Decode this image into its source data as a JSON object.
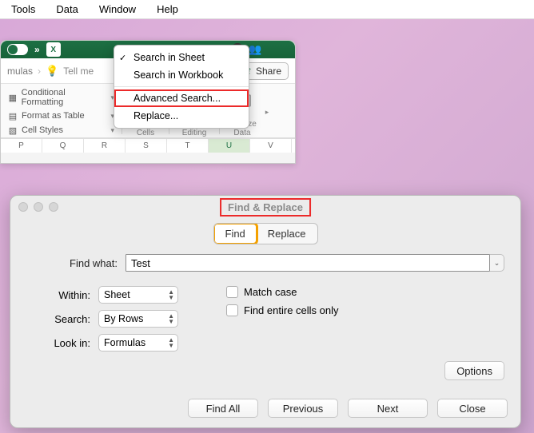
{
  "menubar": {
    "items": [
      "Tools",
      "Data",
      "Window",
      "Help"
    ]
  },
  "ribbon": {
    "tab": "mulas",
    "tellme": "Tell me",
    "share": "Share",
    "styles": {
      "conditional": "Conditional Formatting",
      "format_table": "Format as Table",
      "cell_styles": "Cell Styles"
    },
    "groups": {
      "cells": "Cells",
      "editing": "Editing",
      "analyze": "Analyze\nData"
    }
  },
  "columns": [
    "P",
    "Q",
    "R",
    "S",
    "T",
    "U",
    "V"
  ],
  "dropdown": {
    "search_sheet": "Search in Sheet",
    "search_workbook": "Search in Workbook",
    "advanced": "Advanced Search...",
    "replace": "Replace..."
  },
  "dialog": {
    "title": "Find & Replace",
    "tabs": {
      "find": "Find",
      "replace": "Replace"
    },
    "find_what_label": "Find what:",
    "find_what_value": "Test",
    "within_label": "Within:",
    "within_value": "Sheet",
    "search_label": "Search:",
    "search_value": "By Rows",
    "lookin_label": "Look in:",
    "lookin_value": "Formulas",
    "match_case": "Match case",
    "entire_cells": "Find entire cells only",
    "options_btn": "Options",
    "buttons": {
      "find_all": "Find All",
      "previous": "Previous",
      "next": "Next",
      "close": "Close"
    }
  }
}
